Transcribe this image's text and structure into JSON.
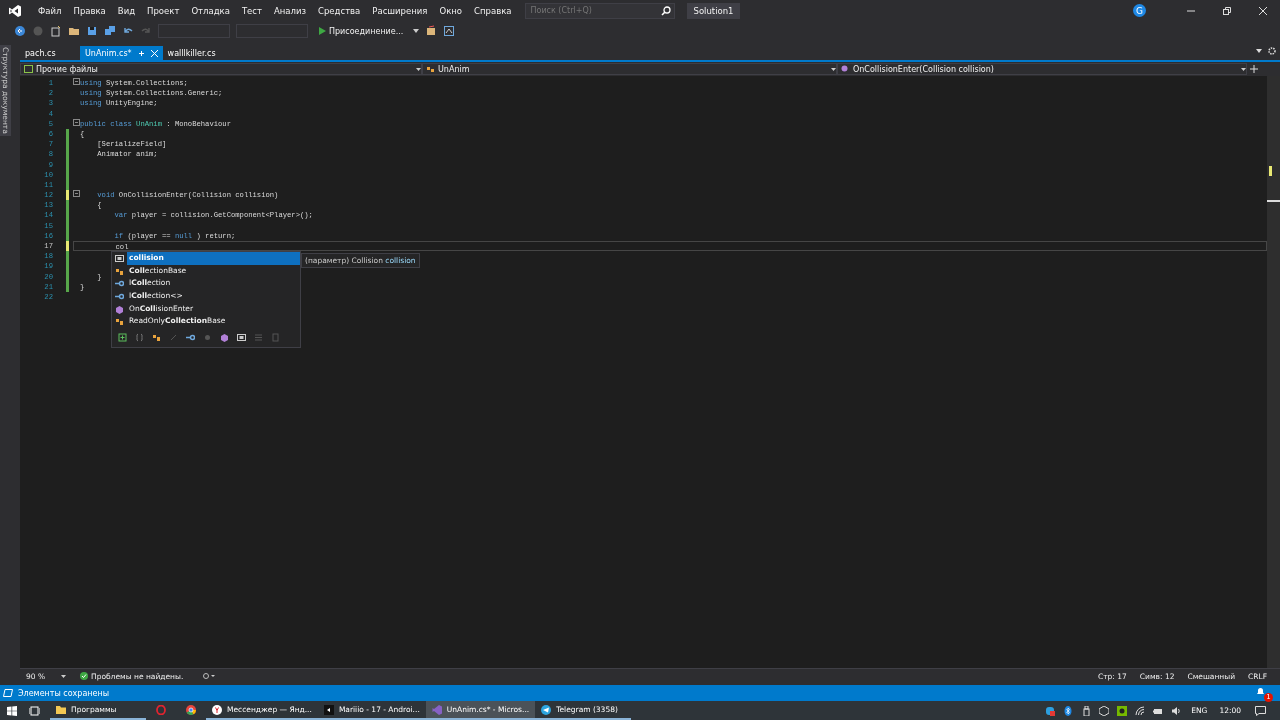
{
  "title_bar": {
    "menu": [
      "Файл",
      "Правка",
      "Вид",
      "Проект",
      "Отладка",
      "Тест",
      "Анализ",
      "Средства",
      "Расширения",
      "Окно",
      "Справка"
    ],
    "search": {
      "placeholder": "Поиск (Ctrl+Q)"
    },
    "solution": "Solution1",
    "account_initial": "G"
  },
  "toolbar": {
    "attach_button": "Присоединение..."
  },
  "tabs": [
    {
      "label": "pach.cs",
      "selected": false
    },
    {
      "label": "UnAnim.cs*",
      "selected": true
    },
    {
      "label": "walllkiller.cs",
      "selected": false
    }
  ],
  "side_panel": {
    "label": "Структура документа"
  },
  "nav_bar": {
    "project": "Прочие файлы",
    "type": "UnAnim",
    "member": "OnCollisionEnter(Collision collision)"
  },
  "editor": {
    "lines": [
      {
        "number": "1",
        "current": false,
        "fold": true,
        "tokens": [
          {
            "text": "using",
            "kind": "keyword"
          },
          {
            "text": "System.Collections;",
            "kind": "plain"
          }
        ]
      },
      {
        "number": "2",
        "current": false,
        "fold": false,
        "tokens": [
          {
            "text": "using",
            "kind": "keyword"
          },
          {
            "text": "System.Collections.Generic;",
            "kind": "plain"
          }
        ]
      },
      {
        "number": "3",
        "current": false,
        "fold": false,
        "tokens": [
          {
            "text": "using",
            "kind": "keyword"
          },
          {
            "text": "UnityEngine;",
            "kind": "plain"
          }
        ]
      },
      {
        "number": "4",
        "current": false,
        "fold": false
      },
      {
        "number": "5",
        "current": false,
        "fold": true,
        "tokens": [
          {
            "text": "public class",
            "kind": "keyword"
          },
          {
            "text": "UnAnim",
            "kind": "type"
          },
          {
            "text": ": MonoBehaviour",
            "kind": "plain"
          }
        ]
      },
      {
        "number": "6",
        "color": "#57a64a",
        "current": false,
        "fold": false,
        "tokens": [
          {
            "text": "{",
            "kind": "plain"
          }
        ]
      },
      {
        "number": "7",
        "color": "#57a64a",
        "current": false,
        "fold": false,
        "tokens": [
          {
            "text": "    [SerializeField]",
            "kind": "plain"
          }
        ]
      },
      {
        "number": "8",
        "color": "#57a64a",
        "current": false,
        "fold": false,
        "tokens": [
          {
            "text": "    Animator anim;",
            "kind": "plain"
          }
        ]
      },
      {
        "number": "9",
        "color": "#57a64a",
        "current": false,
        "fold": false
      },
      {
        "number": "10",
        "color": "#57a64a",
        "current": false,
        "fold": false
      },
      {
        "number": "11",
        "color": "#57a64a",
        "current": false,
        "fold": false
      },
      {
        "number": "12",
        "color": "#e8e873",
        "current": false,
        "fold": true,
        "tokens": [
          {
            "text": "    void",
            "kind": "keyword"
          },
          {
            "text": "OnCollisionEnter(Collision collision)",
            "kind": "plain"
          }
        ]
      },
      {
        "number": "13",
        "color": "#57a64a",
        "current": false,
        "fold": false,
        "tokens": [
          {
            "text": "    {",
            "kind": "plain"
          }
        ]
      },
      {
        "number": "14",
        "color": "#57a64a",
        "current": false,
        "fold": false,
        "tokens": [
          {
            "text": "        var",
            "kind": "keyword"
          },
          {
            "text": "player = collision.GetComponent<Player>();",
            "kind": "plain"
          }
        ]
      },
      {
        "number": "15",
        "color": "#57a64a",
        "current": false,
        "fold": false
      },
      {
        "number": "16",
        "color": "#57a64a",
        "current": false,
        "fold": false,
        "tokens": [
          {
            "text": "        if",
            "kind": "keyword"
          },
          {
            "text": "(player ==",
            "kind": "plain"
          },
          {
            "text": "null",
            "kind": "keyword"
          },
          {
            "text": ") return;",
            "kind": "plain"
          }
        ]
      },
      {
        "number": "17",
        "color": "#e8e873",
        "current": true,
        "fold": false,
        "tokens": [
          {
            "text": "        col",
            "kind": "plain"
          }
        ]
      },
      {
        "number": "18",
        "color": "#57a64a",
        "current": false,
        "fold": false
      },
      {
        "number": "19",
        "color": "#57a64a",
        "current": false,
        "fold": false
      },
      {
        "number": "20",
        "color": "#57a64a",
        "current": false,
        "fold": false,
        "tokens": [
          {
            "text": "    }",
            "kind": "plain"
          }
        ]
      },
      {
        "number": "21",
        "color": "#57a64a",
        "current": false,
        "fold": false,
        "tokens": [
          {
            "text": "}",
            "kind": "plain"
          }
        ]
      },
      {
        "number": "22",
        "current": false,
        "fold": false
      }
    ],
    "completion": {
      "items": [
        {
          "label": "**collision**",
          "kind": "local",
          "selected": true
        },
        {
          "label": "**Coll**ectionBase",
          "kind": "class",
          "selected": false
        },
        {
          "label": "I**Coll**ection",
          "kind": "interface",
          "selected": false
        },
        {
          "label": "I**Coll**ection<>",
          "kind": "interface",
          "selected": false
        },
        {
          "label": "On**Coll**isionEnter",
          "kind": "method",
          "selected": false
        },
        {
          "label": "ReadOnly**Collection**Base",
          "kind": "class",
          "selected": false
        }
      ],
      "tooltip": {
        "prefix": "(параметр) Collision",
        "name": "collision"
      }
    }
  },
  "status_row": {
    "zoom": "90 %",
    "problems": "Проблемы не найдены.",
    "line": "Стр: 17",
    "column": "Симв: 12",
    "whitespace": "Смешанный",
    "line_ending": "CRLF"
  },
  "status_bar": {
    "message": "Элементы сохранены",
    "notifications": "1"
  },
  "taskbar": {
    "items": [
      {
        "label": "Программы",
        "kind": "folder",
        "selected": false
      },
      {
        "kind": "opera",
        "selected": false
      },
      {
        "kind": "chrome",
        "selected": false
      },
      {
        "label": "Мессенджер — Янд...",
        "kind": "yandex",
        "selected": false
      },
      {
        "label": "Mariiio - 17 - Androi...",
        "kind": "unity",
        "selected": false
      },
      {
        "label": "UnAnim.cs* - Micros...",
        "kind": "vs",
        "selected": true
      },
      {
        "label": "Telegram (3358)",
        "kind": "telegram",
        "selected": false
      }
    ],
    "language": "ENG",
    "time": "12:00"
  }
}
